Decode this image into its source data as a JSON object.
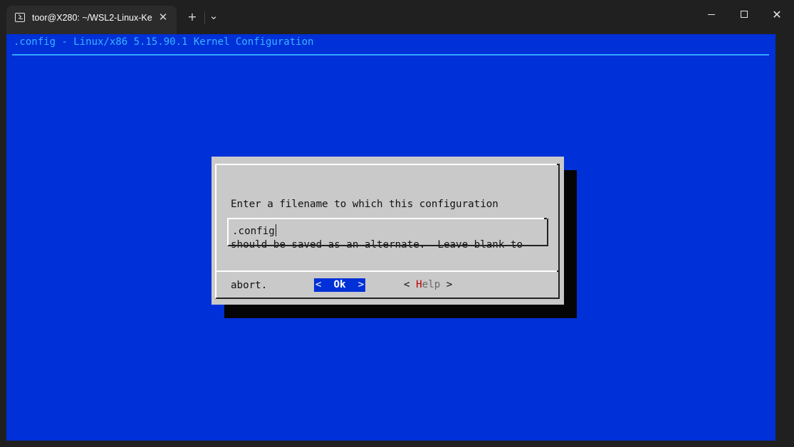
{
  "window": {
    "tab_title": "toor@X280: ~/WSL2-Linux-Ke",
    "tab_close_glyph": "✕",
    "new_tab_glyph": "+",
    "dropdown_glyph": "⌄",
    "close_glyph": "✕"
  },
  "terminal": {
    "background_color": "#0030d8",
    "backtitle": ".config - Linux/x86 5.15.90.1 Kernel Configuration"
  },
  "dialog": {
    "prompt_lines": [
      "Enter a filename to which this configuration",
      "should be saved as an alternate.  Leave blank to",
      "abort."
    ],
    "input_value": ".config",
    "ok_button": {
      "left": "<  ",
      "label": "Ok",
      "right": "  >"
    },
    "help_button": {
      "left": "< ",
      "hotkey": "H",
      "rest": "elp",
      "right": " >"
    }
  }
}
